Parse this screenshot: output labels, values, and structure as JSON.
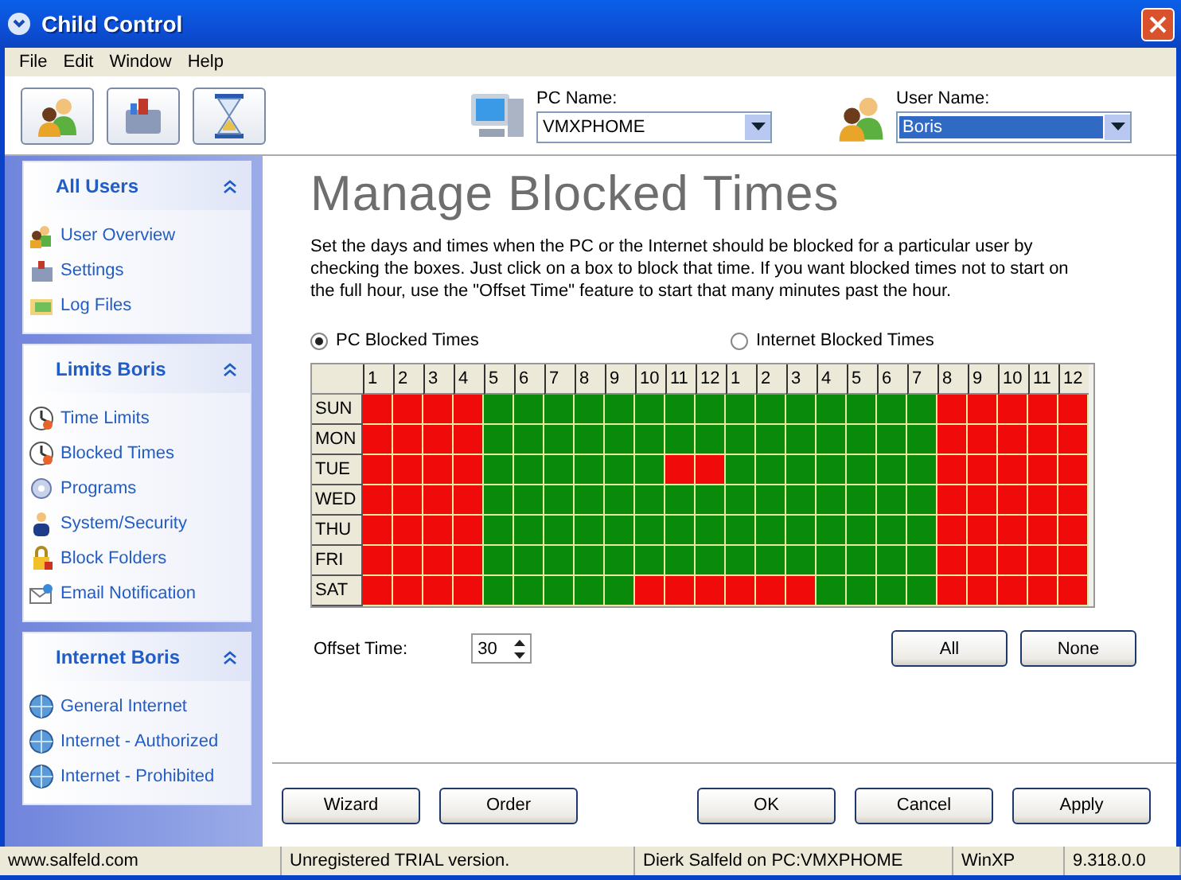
{
  "window": {
    "title": "Child Control"
  },
  "menu": [
    "File",
    "Edit",
    "Window",
    "Help"
  ],
  "toolbar": {
    "pc_name": {
      "label": "PC Name:",
      "value": "VMXPHOME"
    },
    "user_name": {
      "label": "User Name:",
      "value": "Boris",
      "selected": true
    }
  },
  "sidebar": [
    {
      "title": "All Users",
      "expanded": true,
      "items": [
        "User Overview",
        "Settings",
        "Log Files"
      ]
    },
    {
      "title": "Limits Boris",
      "expanded": true,
      "items": [
        "Time Limits",
        "Blocked Times",
        "Programs",
        "System/Security",
        "Block Folders",
        "Email Notification"
      ]
    },
    {
      "title": "Internet Boris",
      "expanded": true,
      "items": [
        "General Internet",
        "Internet - Authorized",
        "Internet - Prohibited"
      ]
    }
  ],
  "heading": "Manage Blocked Times",
  "description": "Set the days and times when the PC or the Internet should be blocked for a particular user by checking the boxes. Just click on a box to block that time. If you want blocked times not to start on the full hour, use the \"Offset Time\" feature to start that many minutes past the hour.",
  "modes": [
    {
      "label": "PC Blocked Times",
      "selected": true
    },
    {
      "label": "Internet Blocked Times",
      "selected": false
    }
  ],
  "grid": {
    "hours": [
      "1",
      "2",
      "3",
      "4",
      "5",
      "6",
      "7",
      "8",
      "9",
      "10",
      "11",
      "12",
      "1",
      "2",
      "3",
      "4",
      "5",
      "6",
      "7",
      "8",
      "9",
      "10",
      "11",
      "12"
    ],
    "rows": [
      {
        "day": "SUN",
        "blocked": [
          true,
          true,
          true,
          true,
          false,
          false,
          false,
          false,
          false,
          false,
          false,
          false,
          false,
          false,
          false,
          false,
          false,
          false,
          false,
          true,
          true,
          true,
          true,
          true
        ]
      },
      {
        "day": "MON",
        "blocked": [
          true,
          true,
          true,
          true,
          false,
          false,
          false,
          false,
          false,
          false,
          false,
          false,
          false,
          false,
          false,
          false,
          false,
          false,
          false,
          true,
          true,
          true,
          true,
          true
        ]
      },
      {
        "day": "TUE",
        "blocked": [
          true,
          true,
          true,
          true,
          false,
          false,
          false,
          false,
          false,
          false,
          true,
          true,
          false,
          false,
          false,
          false,
          false,
          false,
          false,
          true,
          true,
          true,
          true,
          true
        ]
      },
      {
        "day": "WED",
        "blocked": [
          true,
          true,
          true,
          true,
          false,
          false,
          false,
          false,
          false,
          false,
          false,
          false,
          false,
          false,
          false,
          false,
          false,
          false,
          false,
          true,
          true,
          true,
          true,
          true
        ]
      },
      {
        "day": "THU",
        "blocked": [
          true,
          true,
          true,
          true,
          false,
          false,
          false,
          false,
          false,
          false,
          false,
          false,
          false,
          false,
          false,
          false,
          false,
          false,
          false,
          true,
          true,
          true,
          true,
          true
        ]
      },
      {
        "day": "FRI",
        "blocked": [
          true,
          true,
          true,
          true,
          false,
          false,
          false,
          false,
          false,
          false,
          false,
          false,
          false,
          false,
          false,
          false,
          false,
          false,
          false,
          true,
          true,
          true,
          true,
          true
        ]
      },
      {
        "day": "SAT",
        "blocked": [
          true,
          true,
          true,
          true,
          false,
          false,
          false,
          false,
          false,
          true,
          true,
          true,
          true,
          true,
          true,
          false,
          false,
          false,
          false,
          true,
          true,
          true,
          true,
          true
        ]
      }
    ]
  },
  "offset": {
    "label": "Offset Time:",
    "value": "30"
  },
  "grid_buttons": [
    "All",
    "None"
  ],
  "left_buttons": [
    "Wizard",
    "Order"
  ],
  "right_buttons": [
    "OK",
    "Cancel",
    "Apply"
  ],
  "status_bar": [
    "www.salfeld.com",
    "Unregistered TRIAL version.",
    "Dierk Salfeld on PC:VMXPHOME",
    "WinXP",
    "9.318.0.0"
  ]
}
